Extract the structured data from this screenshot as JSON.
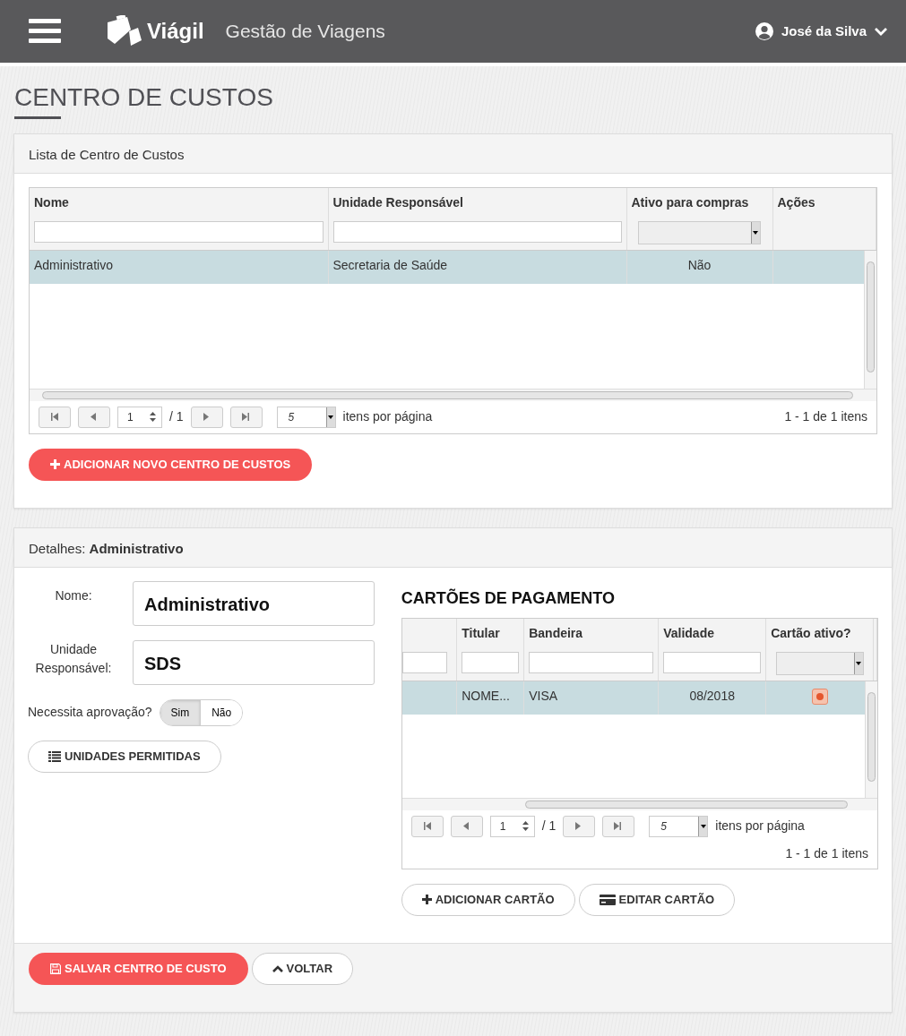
{
  "header": {
    "brand": "Viágil",
    "subtitle": "Gestão de Viagens",
    "user": "José da Silva"
  },
  "page_title": "CENTRO DE CUSTOS",
  "list_panel": {
    "title": "Lista de Centro de Custos",
    "grid": {
      "columns": [
        {
          "label": "Nome",
          "kind": "text"
        },
        {
          "label": "Unidade Responsável",
          "kind": "text"
        },
        {
          "label": "Ativo para compras",
          "kind": "select"
        },
        {
          "label": "Ações"
        }
      ],
      "rows": [
        {
          "cells": [
            "Administrativo",
            "Secretaria de Saúde",
            "Não"
          ],
          "selected": true
        }
      ],
      "pager": {
        "page": "1",
        "of": "/ 1",
        "page_size": "5",
        "page_size_label": "itens por página",
        "summary": "1 - 1 de 1 itens"
      }
    },
    "add_button": "ADICIONAR NOVO CENTRO DE CUSTOS"
  },
  "details_panel": {
    "title_prefix": "Detalhes:",
    "title_name": "Administrativo",
    "fields": [
      {
        "label": "Nome:",
        "value": "Administrativo"
      },
      {
        "label": "Unidade Responsável:",
        "value": "SDS"
      }
    ],
    "approval": {
      "label": "Necessita aprovação?",
      "options": [
        {
          "label": "Sim",
          "selected": true
        },
        {
          "label": "Não",
          "selected": false
        }
      ]
    },
    "units_button": "UNIDADES PERMITIDAS",
    "cards": {
      "title": "CARTÕES DE PAGAMENTO",
      "columns": [
        {
          "kind": "text"
        },
        {
          "label": "Titular",
          "kind": "text"
        },
        {
          "label": "Bandeira",
          "kind": "text"
        },
        {
          "label": "Validade",
          "kind": "text"
        },
        {
          "label": "Cartão ativo?",
          "kind": "select"
        }
      ],
      "rows": [
        {
          "titular": "NOME...",
          "bandeira": "VISA",
          "validade": "08/2018",
          "active": true,
          "selected": true
        }
      ],
      "pager": {
        "page": "1",
        "of": "/ 1",
        "page_size": "5",
        "page_size_label": "itens por página",
        "summary": "1 - 1 de 1 itens"
      }
    },
    "card_buttons": [
      {
        "label": "ADICIONAR CARTÃO",
        "kind": "add"
      },
      {
        "label": "EDITAR CARTÃO",
        "kind": "edit"
      }
    ],
    "footer_buttons": [
      {
        "label": "SALVAR CENTRO DE CUSTO",
        "kind": "save"
      },
      {
        "label": "VOLTAR",
        "kind": "back"
      }
    ]
  }
}
